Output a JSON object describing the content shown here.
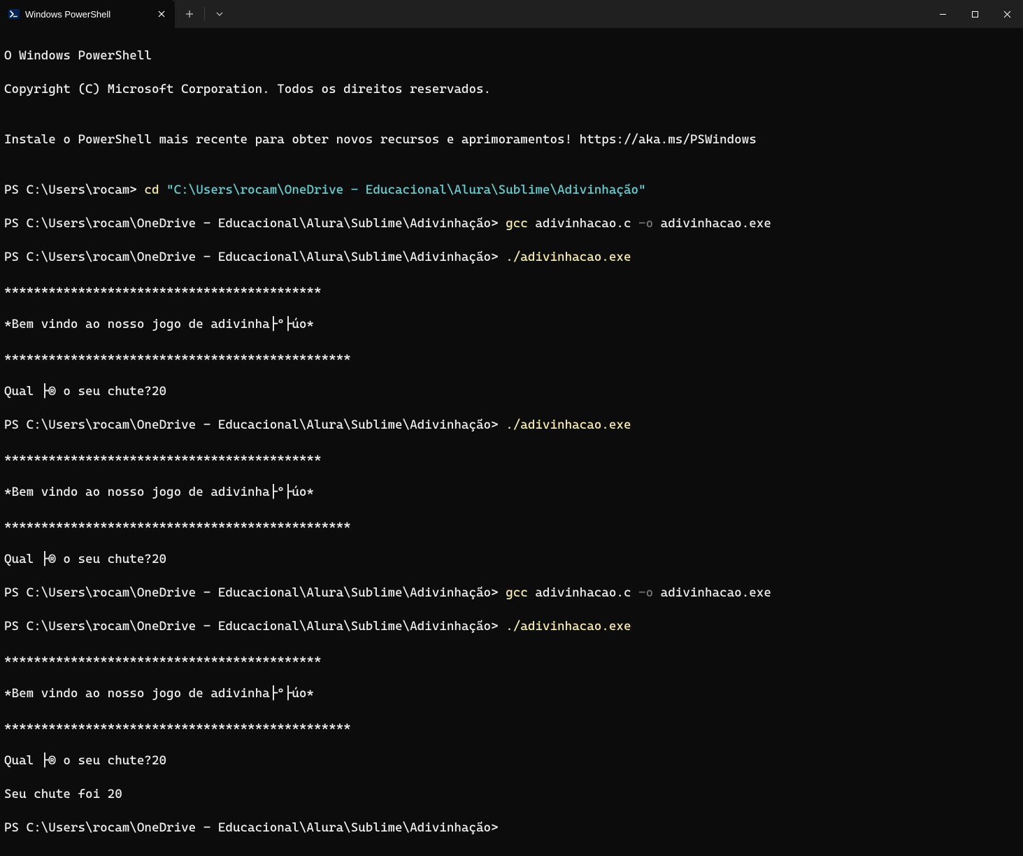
{
  "titlebar": {
    "tab_title": "Windows PowerShell",
    "tab_icon_name": "powershell-icon",
    "new_tab_label": "+",
    "dropdown_label": "⌄"
  },
  "terminal": {
    "header": [
      "O Windows PowerShell",
      "Copyright (C) Microsoft Corporation. Todos os direitos reservados.",
      "",
      "Instale o PowerShell mais recente para obter novos recursos e aprimoramentos! https://aka.ms/PSWindows",
      ""
    ],
    "prompts": {
      "base": "PS C:\\Users\\rocam> ",
      "dir": "PS C:\\Users\\rocam\\OneDrive - Educacional\\Alura\\Sublime\\Adivinhação> "
    },
    "cmd": {
      "cd": {
        "kw": "cd",
        "arg": " \"C:\\Users\\rocam\\OneDrive - Educacional\\Alura\\Sublime\\Adivinhação\""
      },
      "gcc": {
        "kw": "gcc",
        "arg1": " adivinhacao.c ",
        "flag": "-o",
        "arg2": " adivinhacao.exe"
      },
      "run": {
        "exe": "./adivinhacao.exe"
      }
    },
    "out": {
      "stars1": "*******************************************",
      "welcome": "*Bem vindo ao nosso jogo de adivinha├º├úo*",
      "stars2": "***********************************************",
      "question": "Qual ├® o seu chute?20",
      "result": "Seu chute foi 20"
    }
  }
}
